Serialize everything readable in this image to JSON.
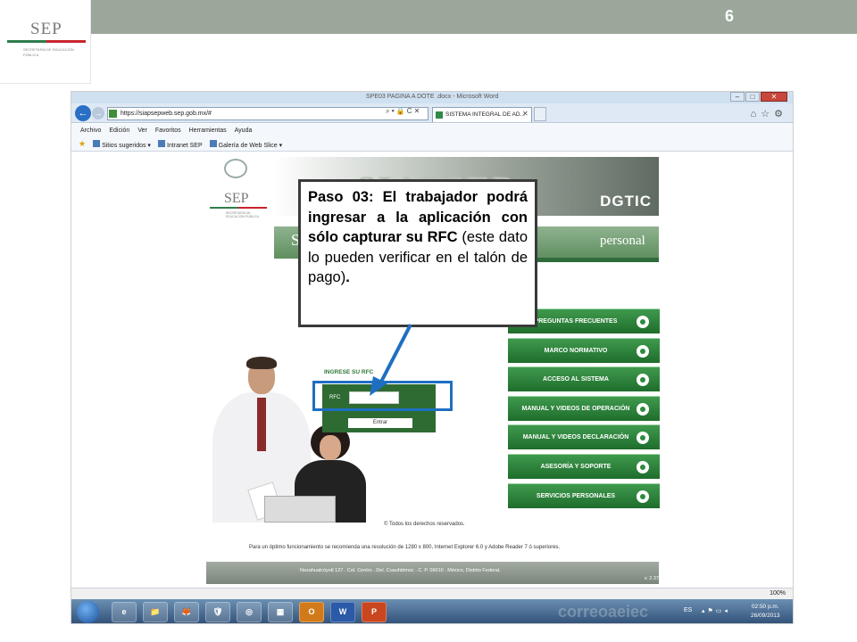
{
  "slide": {
    "page_number": "6",
    "logo_text": "SEP",
    "logo_subtext": "SECRETARÍA DE EDUCACIÓN PÚBLICA"
  },
  "browser": {
    "window_title": "SPE03 PAGINA A DOTE .docx - Microsoft Word",
    "address": "https://siapsepweb.sep.gob.mx/#",
    "tab_title": "SISTEMA INTEGRAL DE AD...",
    "menu": [
      "Archivo",
      "Edición",
      "Ver",
      "Favoritos",
      "Herramientas",
      "Ayuda"
    ],
    "favorites": [
      "Sitios sugeridos ▾",
      "Intranet SEP",
      "Galería de Web Slice ▾"
    ],
    "zoom": "100%"
  },
  "site": {
    "header_logo": "SEP",
    "header_logo_sub": "SECRETARÍA DE EDUCACIÓN PÚBLICA",
    "header_big": "SIAPSEP",
    "header_dgtic": "DGTIC",
    "banner_left": "S",
    "banner_right": "personal",
    "menu_buttons": [
      "PREGUNTAS FRECUENTES",
      "MARCO NORMATIVO",
      "ACCESO AL SISTEMA",
      "MANUAL Y VIDEOS DE OPERACIÓN",
      "MANUAL Y VIDEOS DECLARACIÓN",
      "ASESORÍA Y SOPORTE",
      "SERVICIOS PERSONALES"
    ],
    "login_title": "INGRESE SU RFC",
    "rfc_label": "RFC",
    "rfc_value": "",
    "enter_label": "Entrar",
    "copyright": "© Todos los derechos reservados.",
    "recommendation": "Para un óptimo funcionamiento se recomienda una resolución de 1280 x 800, Internet Explorer 6.0 y Adobe Reader 7 ó superiores.",
    "footer_address": "Nezahualcóyotl 127 . Col. Centro . Del. Cuauhtémoc . C. P. 06010 . México, Distrito Federal.",
    "footer_version": "v. 2.37"
  },
  "taskbar": {
    "apps": [
      "e",
      "📁",
      "🦊",
      "🛡",
      "◎",
      "▦",
      "O",
      "W",
      "P"
    ],
    "ghost_text": "correoaeiec",
    "language": "ES",
    "time": "02:50 p.m.",
    "date": "26/09/2013"
  },
  "callout": {
    "bold_text": "Paso 03: El trabajador podrá ingresar a la aplicación con sólo capturar su RFC",
    "normal_text": " (este dato lo pueden verificar en el talón de pago)",
    "end_bold": "."
  },
  "colors": {
    "highlight": "#1e6fc2",
    "site_green": "#2e6b33",
    "menu_green": "#1f6d2c"
  }
}
